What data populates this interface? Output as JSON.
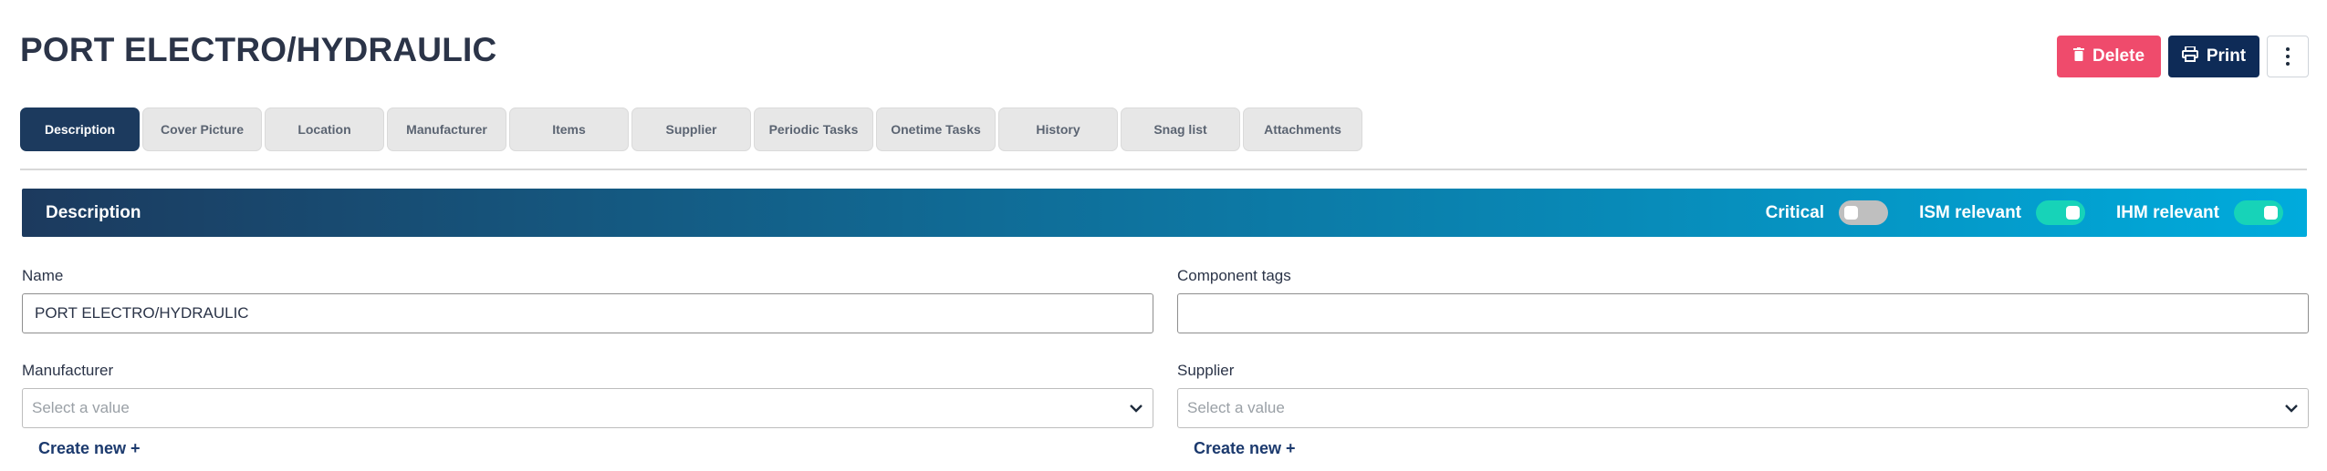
{
  "header": {
    "title": "PORT ELECTRO/HYDRAULIC",
    "delete_label": "Delete",
    "print_label": "Print",
    "delete_color": "#ef4b6c",
    "print_color": "#0e2b57"
  },
  "tabs": [
    {
      "label": "Description",
      "active": true
    },
    {
      "label": "Cover Picture",
      "active": false
    },
    {
      "label": "Location",
      "active": false
    },
    {
      "label": "Manufacturer",
      "active": false
    },
    {
      "label": "Items",
      "active": false
    },
    {
      "label": "Supplier",
      "active": false
    },
    {
      "label": "Periodic Tasks",
      "active": false
    },
    {
      "label": "Onetime Tasks",
      "active": false
    },
    {
      "label": "History",
      "active": false
    },
    {
      "label": "Snag list",
      "active": false
    },
    {
      "label": "Attachments",
      "active": false
    }
  ],
  "section": {
    "title": "Description",
    "toggles": [
      {
        "label": "Critical",
        "on": false
      },
      {
        "label": "ISM relevant",
        "on": true
      },
      {
        "label": "IHM relevant",
        "on": true
      }
    ]
  },
  "form": {
    "name": {
      "label": "Name",
      "value": "PORT ELECTRO/HYDRAULIC"
    },
    "component_tags": {
      "label": "Component tags",
      "value": ""
    },
    "manufacturer": {
      "label": "Manufacturer",
      "placeholder": "Select a value",
      "create_label": "Create new +"
    },
    "supplier": {
      "label": "Supplier",
      "placeholder": "Select a value",
      "create_label": "Create new +"
    }
  }
}
